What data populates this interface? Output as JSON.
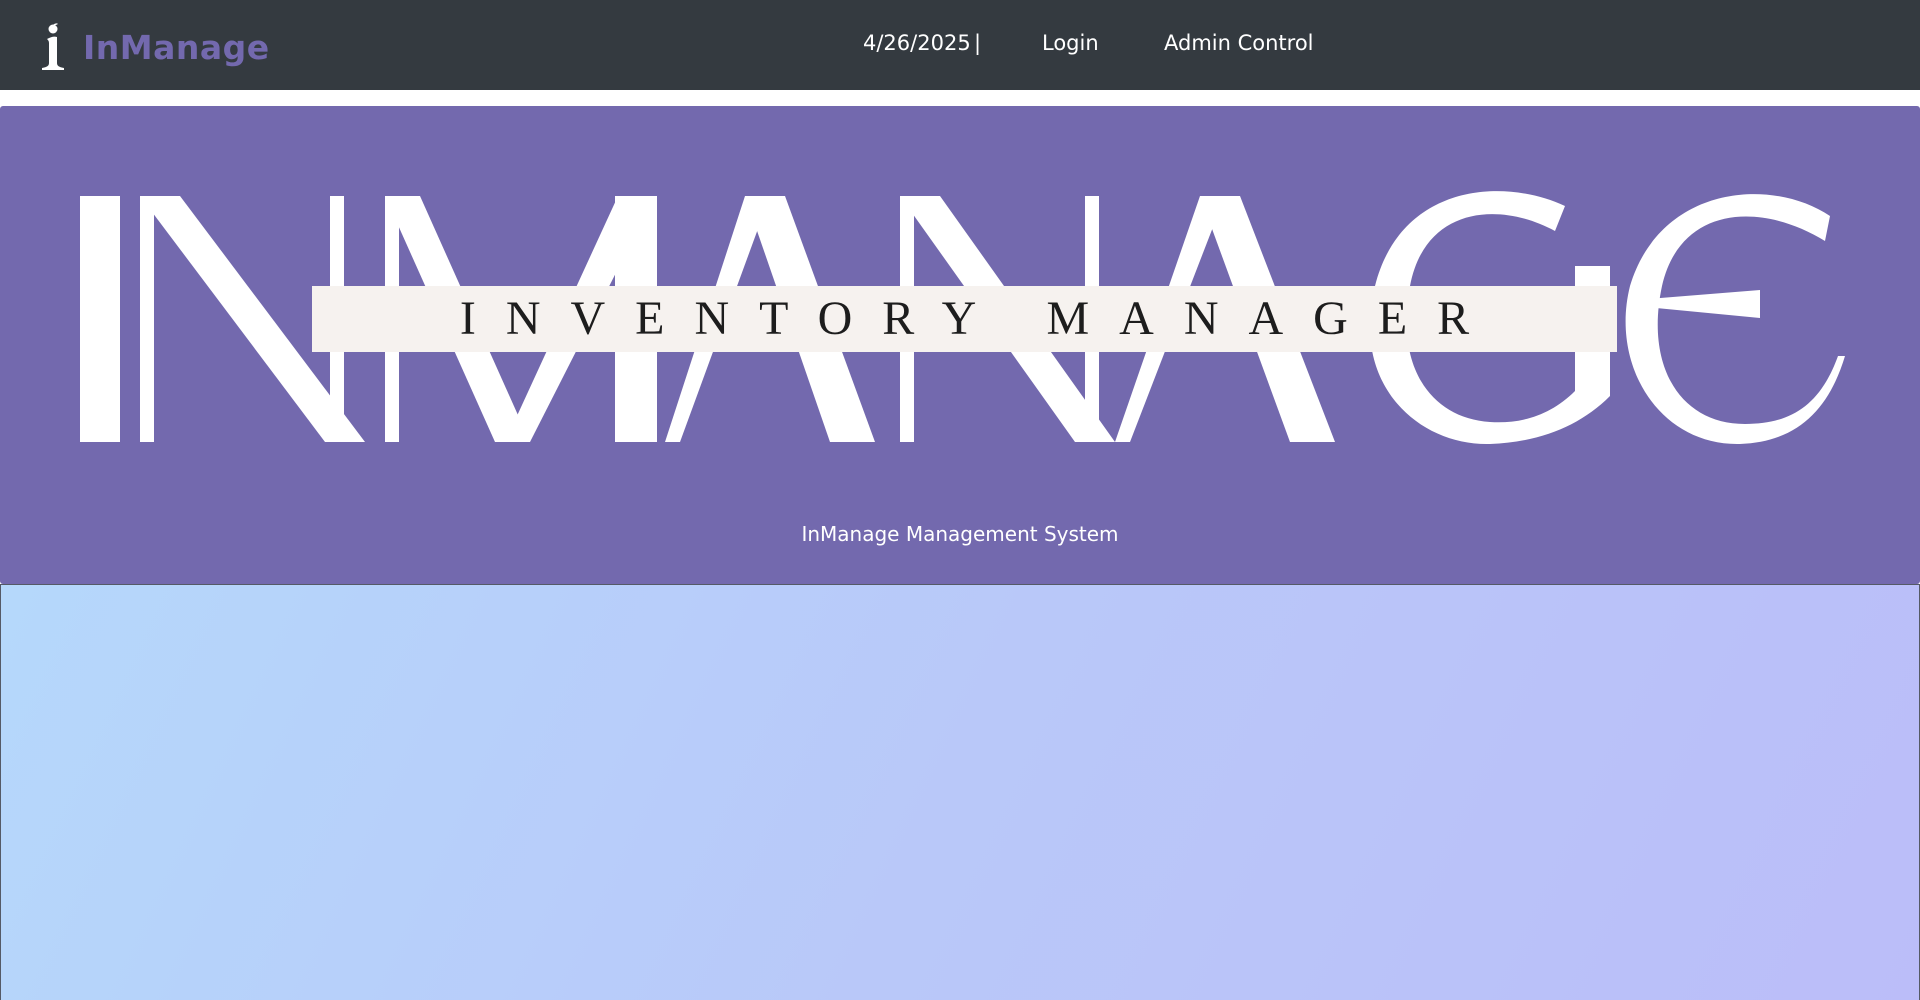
{
  "navbar": {
    "brand_name": "InManage",
    "brand_icon": "inmanage-logo-icon",
    "date": "4/26/2025",
    "separator": "|",
    "links": {
      "login": "Login",
      "admin": "Admin Control"
    }
  },
  "hero": {
    "logo_wordmark": "INMANAGE",
    "logo_tagline": "INVENTORY MANAGER",
    "subtitle": "InManage Management System"
  },
  "colors": {
    "navbar_bg": "#343a40",
    "brand_accent": "#7369ae",
    "hero_bg": "#7369ae",
    "tagline_band": "#f6f2ef",
    "gradient_start": "#b5d8fb",
    "gradient_end": "#bbbdf9"
  }
}
